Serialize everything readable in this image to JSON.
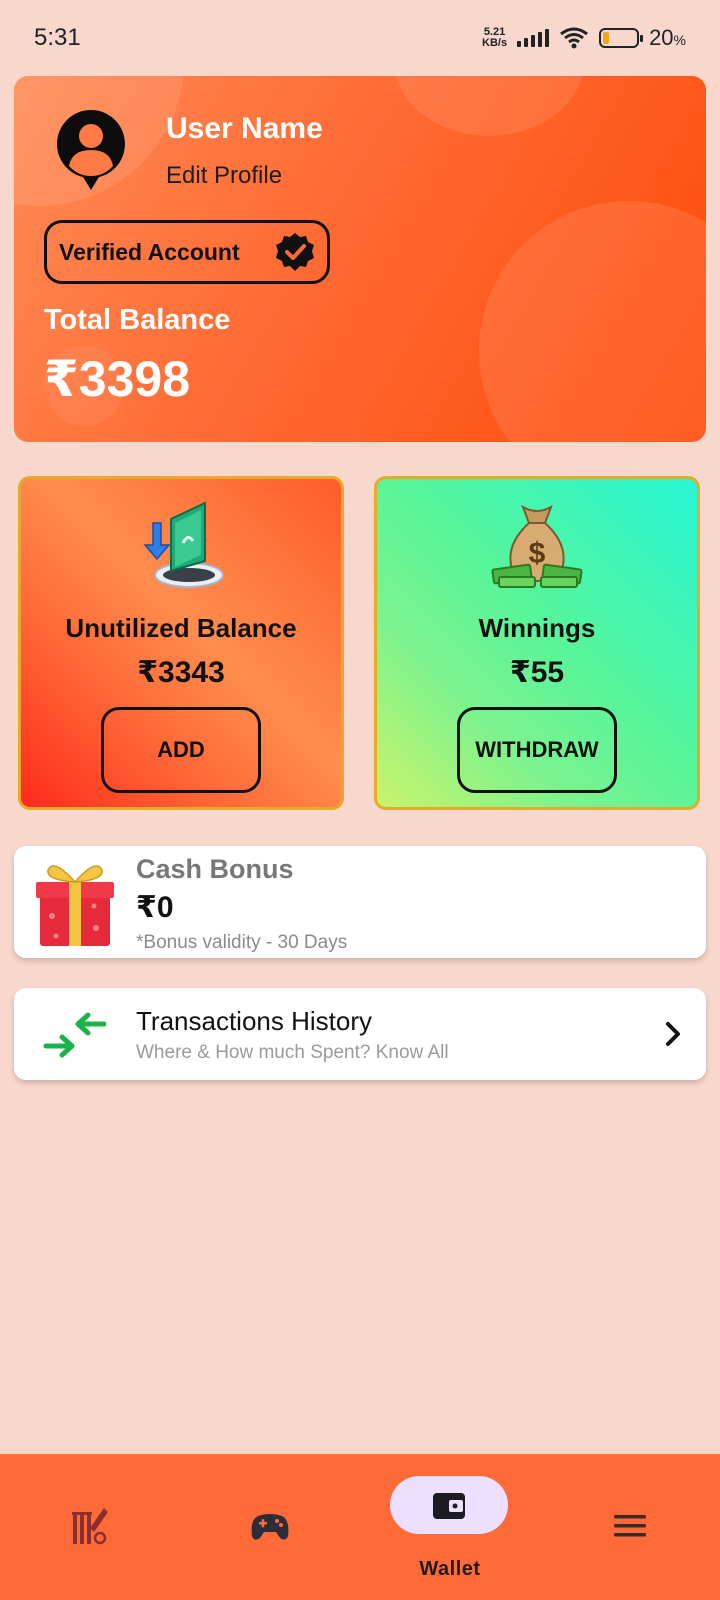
{
  "status_bar": {
    "time": "5:31",
    "net_speed_value": "5.21",
    "net_speed_unit": "KB/s",
    "battery_percent": "20",
    "battery_unit": "%",
    "battery_level": 0.2
  },
  "profile": {
    "user_name": "User Name",
    "edit_label": "Edit Profile",
    "verified_label": "Verified Account",
    "total_label": "Total Balance",
    "total_value": "₹3398"
  },
  "unutilized": {
    "title": "Unutilized Balance",
    "amount": "₹3343",
    "button": "ADD"
  },
  "winnings": {
    "title": "Winnings",
    "amount": "₹55",
    "button": "WITHDRAW"
  },
  "cash_bonus": {
    "title": "Cash Bonus",
    "amount": "₹0",
    "validity": "*Bonus validity - 30 Days"
  },
  "transactions": {
    "title": "Transactions History",
    "subtitle": "Where & How much Spent? Know All"
  },
  "bottom_nav": {
    "items": [
      {
        "icon": "cricket-icon",
        "label": ""
      },
      {
        "icon": "gamepad-icon",
        "label": ""
      },
      {
        "icon": "wallet-icon",
        "label": "Wallet",
        "active": true
      },
      {
        "icon": "menu-icon",
        "label": ""
      }
    ]
  },
  "colors": {
    "background": "#f8d8cc",
    "primary_orange": "#ff6a38",
    "winnings_green": "#55f59a",
    "active_pill": "#ecdfff"
  }
}
